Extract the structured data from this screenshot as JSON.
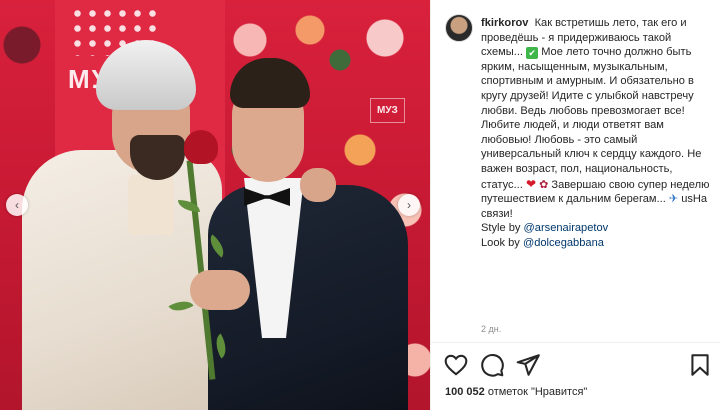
{
  "post": {
    "username": "fkirkorov",
    "caption_lines": [
      "Как встретишь лето, так его и проведёшь - я придерживаюсь такой схемы...",
      "Мое лето точно должно быть ярким, насыщенным, музыкальным, спортивным и амурным. И обязательно в кругу друзей! Идите с улыбкой навстречу любви. Ведь любовь превозмогает все! Любите людей, и люди ответят вам любовью! Любовь - это самый универсальный ключ к сердцу каждого. Не важен возраст, пол, национальность, статус...",
      "Завершаю свою супер неделю путешествием к дальним берегам...",
      "usНа связи!"
    ],
    "style_prefix": "Style by ",
    "style_mention": "@arsenairapetov",
    "look_prefix": "Look by ",
    "look_mention": "@dolcegabbana",
    "time_ago": "2 дн.",
    "likes_count": "100 052",
    "likes_label": "отметок \"Нравится\""
  },
  "photo": {
    "logo_text": "МУ",
    "logo_text_2": "МУЗ"
  },
  "icons": {
    "check": "check-mark-emoji",
    "heart": "red-heart-emoji",
    "bouquet": "bouquet-emoji",
    "plane": "airplane-emoji",
    "like": "heart-outline-icon",
    "comment": "speech-bubble-icon",
    "share": "paper-plane-icon",
    "save": "bookmark-icon",
    "prev": "chevron-left-icon",
    "next": "chevron-right-icon"
  },
  "colors": {
    "photo_background": "#c91a34",
    "mention": "#00376b",
    "check": "#3fb64a",
    "heart": "#d41a2b"
  }
}
